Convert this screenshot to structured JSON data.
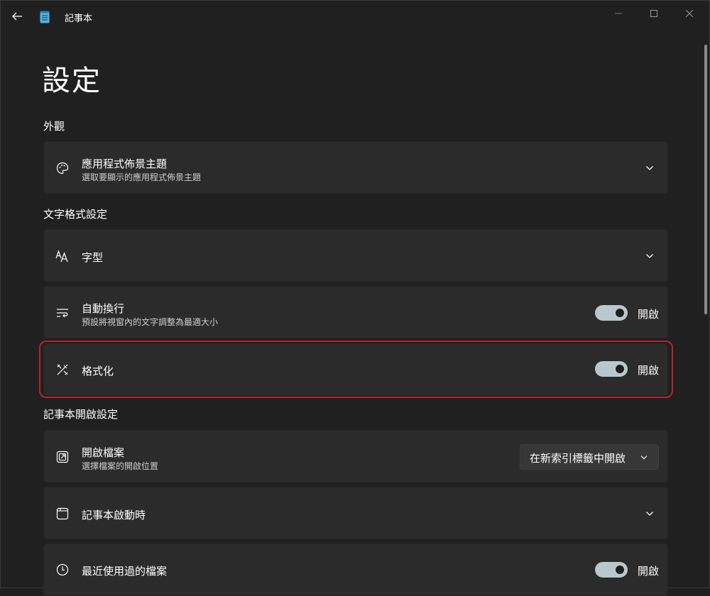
{
  "window": {
    "app_title": "記事本"
  },
  "page": {
    "title": "設定"
  },
  "sections": {
    "appearance": {
      "label": "外觀",
      "theme": {
        "title": "應用程式佈景主題",
        "subtitle": "選取要顯示的應用程式佈景主題"
      }
    },
    "text_format": {
      "label": "文字格式設定",
      "font": {
        "title": "字型"
      },
      "word_wrap": {
        "title": "自動換行",
        "subtitle": "預設將視窗內的文字調整為最適大小",
        "state_label": "開啟",
        "on": true
      },
      "formatting": {
        "title": "格式化",
        "state_label": "開啟",
        "on": true
      }
    },
    "notepad_open": {
      "label": "記事本開啟設定",
      "open_file": {
        "title": "開啟檔案",
        "subtitle": "選擇檔案的開啟位置",
        "selected": "在新索引標籤中開啟"
      },
      "on_startup": {
        "title": "記事本啟動時"
      },
      "recent_files": {
        "title": "最近使用過的檔案",
        "state_label": "開啟",
        "on": true
      }
    }
  },
  "icons": {
    "back": "back-arrow-icon",
    "app": "notepad-icon",
    "minimize": "minimize-icon",
    "maximize": "maximize-icon",
    "close": "close-icon",
    "theme": "palette-icon",
    "font": "font-icon",
    "word_wrap": "word-wrap-icon",
    "formatting": "formatting-icon",
    "open_file": "open-file-icon",
    "startup": "window-icon",
    "recent": "clock-icon",
    "chevron": "chevron-down-icon"
  },
  "colors": {
    "background": "#202020",
    "card": "#2b2b2b",
    "toggle_on": "#b9c8cc",
    "highlight": "#b8232a"
  }
}
